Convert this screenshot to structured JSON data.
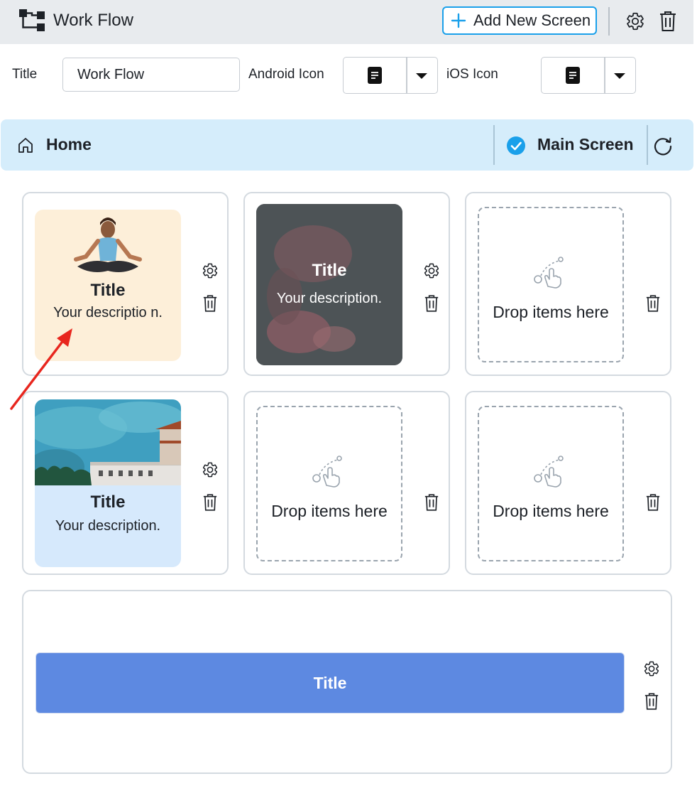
{
  "header": {
    "app_title": "Work Flow",
    "add_screen_label": "Add New Screen"
  },
  "config": {
    "title_label": "Title",
    "title_value": "Work Flow",
    "android_icon_label": "Android Icon",
    "ios_icon_label": "iOS Icon"
  },
  "screens": {
    "home_label": "Home",
    "main_label": "Main Screen"
  },
  "cards": [
    {
      "type": "image-tile",
      "title": "Title",
      "description": "Your descriptio n.",
      "background": "#fdefd9"
    },
    {
      "type": "image-tile",
      "title": "Title",
      "description": "Your description.",
      "background": "#4f5457"
    },
    {
      "type": "drop-zone",
      "text": "Drop items here"
    },
    {
      "type": "image-tile",
      "title": "Title",
      "description": "Your description.",
      "background": "#d6e9fc"
    },
    {
      "type": "drop-zone",
      "text": "Drop items here"
    },
    {
      "type": "drop-zone",
      "text": "Drop items here"
    }
  ],
  "wide_card": {
    "button_label": "Title",
    "color": "#5d89e1"
  },
  "colors": {
    "accent": "#1aa0ea",
    "screenbar": "#d5edfb",
    "annotation_arrow": "#e8261e"
  }
}
